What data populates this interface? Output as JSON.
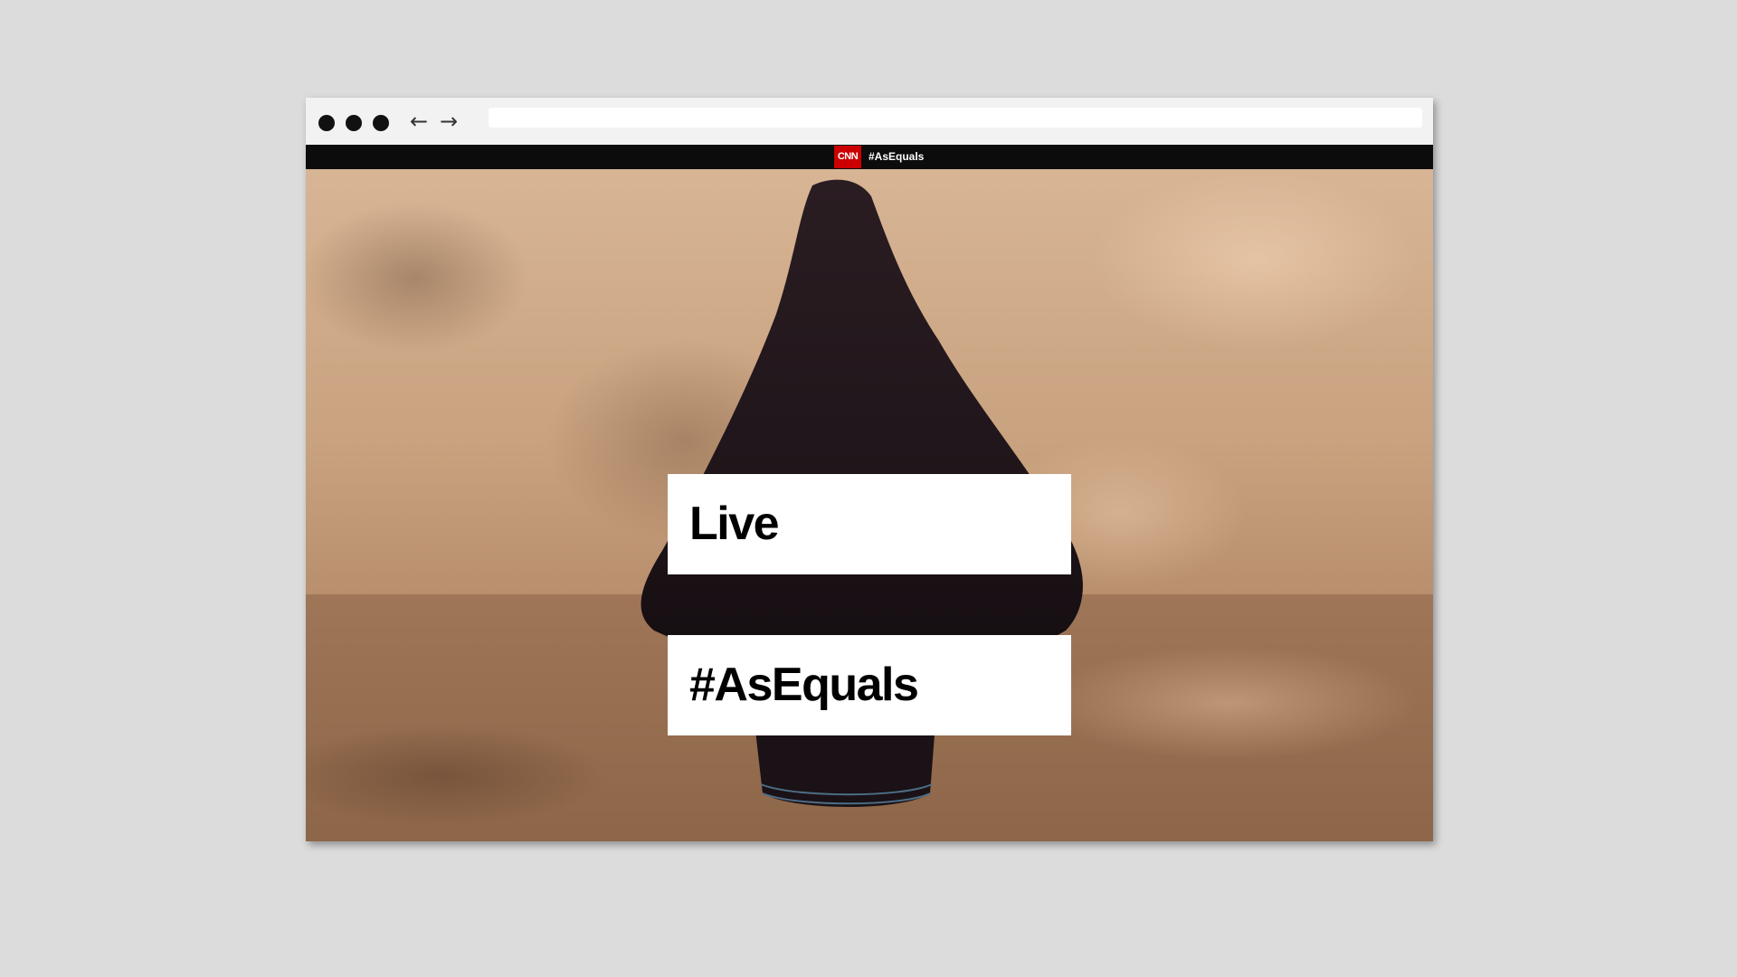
{
  "browser": {
    "address_value": ""
  },
  "site": {
    "logo_text": "CNN",
    "logo_color": "#cc0000",
    "header_tag": "#AsEquals"
  },
  "icons": {
    "back": "arrow-left-icon",
    "forward": "arrow-right-icon",
    "window_dots": [
      "window-dot-icon",
      "window-dot-icon",
      "window-dot-icon"
    ]
  },
  "hero": {
    "line1": "Live",
    "line2": "#AsEquals"
  }
}
